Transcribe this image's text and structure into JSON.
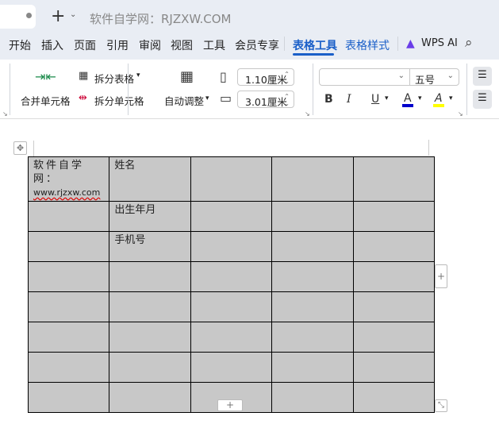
{
  "tabbar": {
    "title": "软件自学网：RJZXW.COM",
    "new_tab": "+",
    "dropdown": "⌄"
  },
  "menu": {
    "items": [
      "开始",
      "插入",
      "页面",
      "引用",
      "审阅",
      "视图",
      "工具",
      "会员专享"
    ],
    "active": "表格工具",
    "table_style": "表格样式",
    "ai": "WPS AI"
  },
  "ribbon": {
    "merge": "合并单元格",
    "split_table": "拆分表格",
    "split_cell": "拆分单元格",
    "autofit": "自动调整",
    "row_height": "1.10厘米",
    "col_width": "3.01厘米",
    "font_name": "",
    "font_size": "五号",
    "bold": "B",
    "italic": "I",
    "underline": "U",
    "font_color": "A",
    "highlight": "A"
  },
  "colors": {
    "accent": "#1a5fc8",
    "font_color": "#0000cc",
    "highlight": "#ffff00",
    "cell_bg": "#c8c8c8"
  },
  "table": {
    "rows": [
      [
        "软件自学网：",
        "姓名",
        "",
        "",
        ""
      ],
      [
        "",
        "出生年月",
        "",
        "",
        ""
      ],
      [
        "",
        "手机号",
        "",
        "",
        ""
      ],
      [
        "",
        "",
        "",
        "",
        ""
      ],
      [
        "",
        "",
        "",
        "",
        ""
      ],
      [
        "",
        "",
        "",
        "",
        ""
      ],
      [
        "",
        "",
        "",
        "",
        ""
      ],
      [
        "",
        "",
        "",
        "",
        ""
      ]
    ],
    "url": "www.rjzxw.com"
  },
  "handles": {
    "add_row": "+",
    "add_col": "+",
    "resize": "⤡",
    "move": "✥"
  }
}
